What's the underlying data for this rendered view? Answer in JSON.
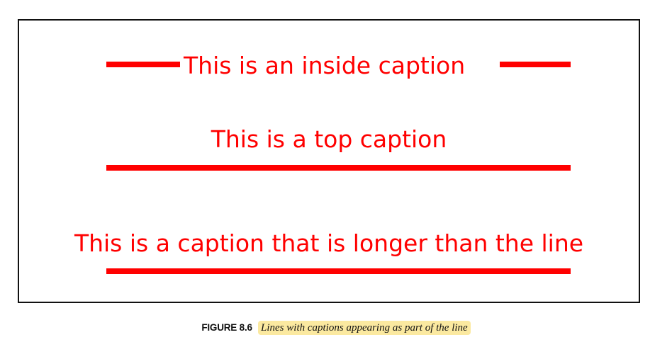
{
  "figure": {
    "captions": {
      "inside": "This is an inside caption",
      "top": "This is a top caption",
      "longer": "This is a caption that is longer than the line"
    },
    "label": "FIGURE 8.6",
    "text": "Lines with captions appearing as part of the line"
  },
  "colors": {
    "line": "#ff0000",
    "caption": "#ff0000",
    "frame_border": "#111111",
    "highlight": "#fbe9a0"
  }
}
